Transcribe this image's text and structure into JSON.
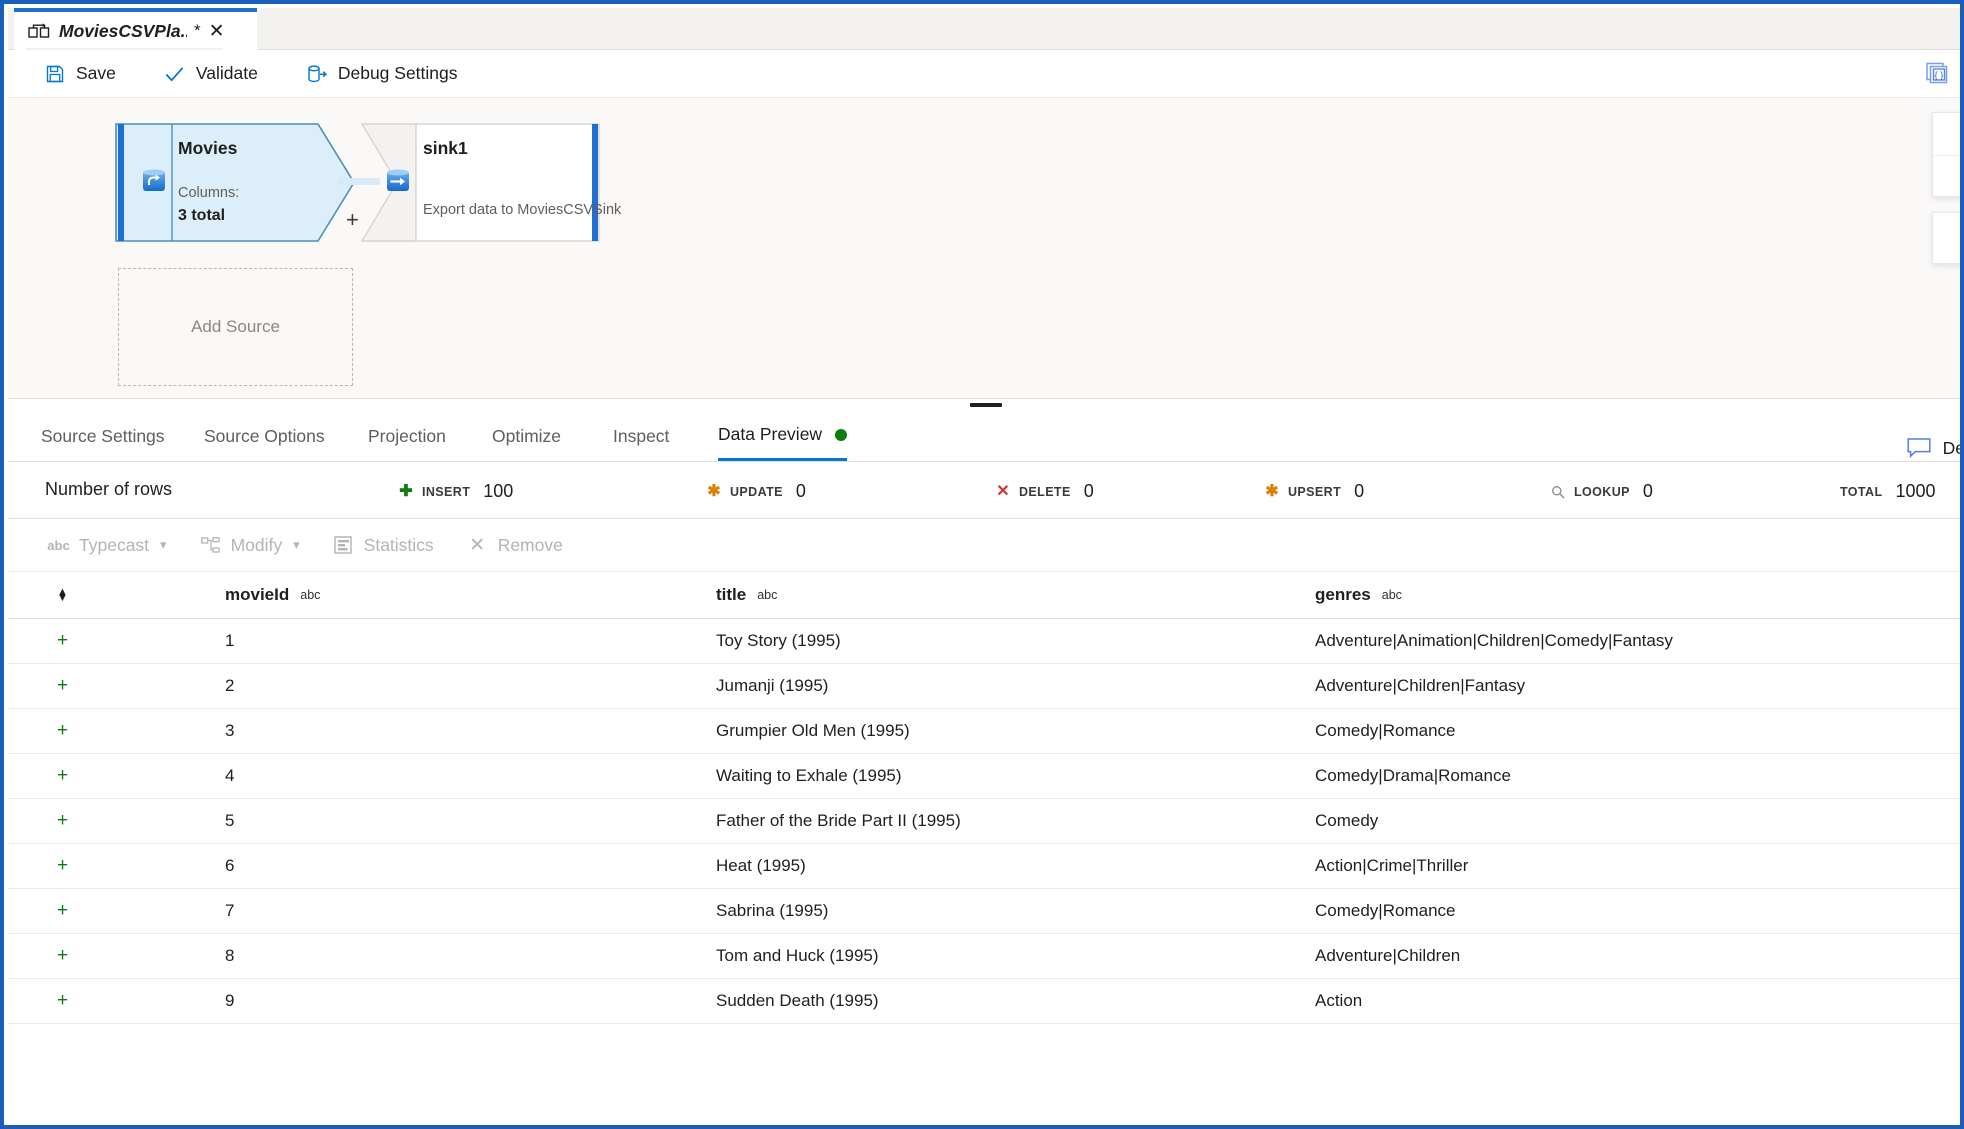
{
  "window": {
    "accent_color": "#1b5fbd",
    "tab": {
      "icon": "dataflow-icon",
      "title": "MoviesCSVPla...",
      "dirty_marker": "*",
      "close_icon": "close-icon",
      "tooltip": "MoviesCSVPlayground"
    }
  },
  "commandbar": {
    "buttons": [
      {
        "label": "Save",
        "icon": "save-icon"
      },
      {
        "label": "Validate",
        "icon": "checkmark-icon"
      },
      {
        "label": "Debug Settings",
        "icon": "debug-settings-icon"
      }
    ],
    "json_view_icon": "code-braces-icon"
  },
  "canvas": {
    "source_node": {
      "title": "Movies",
      "icon": "source-database-icon",
      "columns_label": "Columns:",
      "columns_value": "3 total",
      "add_output_plus": "+"
    },
    "sink_node": {
      "title": "sink1",
      "icon": "sink-database-icon",
      "description": "Export data to MoviesCSVSink"
    },
    "add_source_placeholder": "Add Source",
    "edge_panels": [
      {
        "line1": "",
        "line2": ""
      },
      {
        "line1": "",
        "line2": ""
      }
    ]
  },
  "bottom_panel": {
    "tabs": [
      {
        "label": "Source Settings",
        "active": false,
        "has_dot": false
      },
      {
        "label": "Source Options",
        "active": false,
        "has_dot": false
      },
      {
        "label": "Projection",
        "active": false,
        "has_dot": false
      },
      {
        "label": "Optimize",
        "active": false,
        "has_dot": false
      },
      {
        "label": "Inspect",
        "active": false,
        "has_dot": false
      },
      {
        "label": "Data Preview",
        "active": true,
        "has_dot": true
      }
    ],
    "status_dot_color": "#107c10",
    "description_button": {
      "label": "Descrip",
      "icon": "comment-icon"
    },
    "stats": {
      "title": "Number of rows",
      "items": [
        {
          "label": "INSERT",
          "value": "100",
          "icon": "plus-icon",
          "color": "#107c10"
        },
        {
          "label": "UPDATE",
          "value": "0",
          "icon": "asterisk-icon",
          "color": "#d9820a"
        },
        {
          "label": "DELETE",
          "value": "0",
          "icon": "x-icon",
          "color": "#d13438"
        },
        {
          "label": "UPSERT",
          "value": "0",
          "icon": "asterisk-plus-icon",
          "color": "#d9820a"
        },
        {
          "label": "LOOKUP",
          "value": "0",
          "icon": "magnifier-icon",
          "color": "#8a8886"
        },
        {
          "label": "TOTAL",
          "value": "1000",
          "icon": "",
          "color": "#3b3a39"
        }
      ]
    },
    "grid_toolbar": [
      {
        "label": "Typecast",
        "icon": "abc-icon",
        "has_chevron": true,
        "disabled": true
      },
      {
        "label": "Modify",
        "icon": "modify-icon",
        "has_chevron": true,
        "disabled": true
      },
      {
        "label": "Statistics",
        "icon": "statistics-icon",
        "has_chevron": false,
        "disabled": true
      },
      {
        "label": "Remove",
        "icon": "close-icon",
        "has_chevron": false,
        "disabled": true
      }
    ],
    "table": {
      "sort_icon": "sort-icon",
      "columns": [
        {
          "name": "movieId",
          "type": "abc"
        },
        {
          "name": "title",
          "type": "abc"
        },
        {
          "name": "genres",
          "type": "abc"
        }
      ],
      "row_marker": "+",
      "rows": [
        {
          "movieId": "1",
          "title": "Toy Story (1995)",
          "genres": "Adventure|Animation|Children|Comedy|Fantasy"
        },
        {
          "movieId": "2",
          "title": "Jumanji (1995)",
          "genres": "Adventure|Children|Fantasy"
        },
        {
          "movieId": "3",
          "title": "Grumpier Old Men (1995)",
          "genres": "Comedy|Romance"
        },
        {
          "movieId": "4",
          "title": "Waiting to Exhale (1995)",
          "genres": "Comedy|Drama|Romance"
        },
        {
          "movieId": "5",
          "title": "Father of the Bride Part II (1995)",
          "genres": "Comedy"
        },
        {
          "movieId": "6",
          "title": "Heat (1995)",
          "genres": "Action|Crime|Thriller"
        },
        {
          "movieId": "7",
          "title": "Sabrina (1995)",
          "genres": "Comedy|Romance"
        },
        {
          "movieId": "8",
          "title": "Tom and Huck (1995)",
          "genres": "Adventure|Children"
        },
        {
          "movieId": "9",
          "title": "Sudden Death (1995)",
          "genres": "Action"
        }
      ]
    }
  }
}
